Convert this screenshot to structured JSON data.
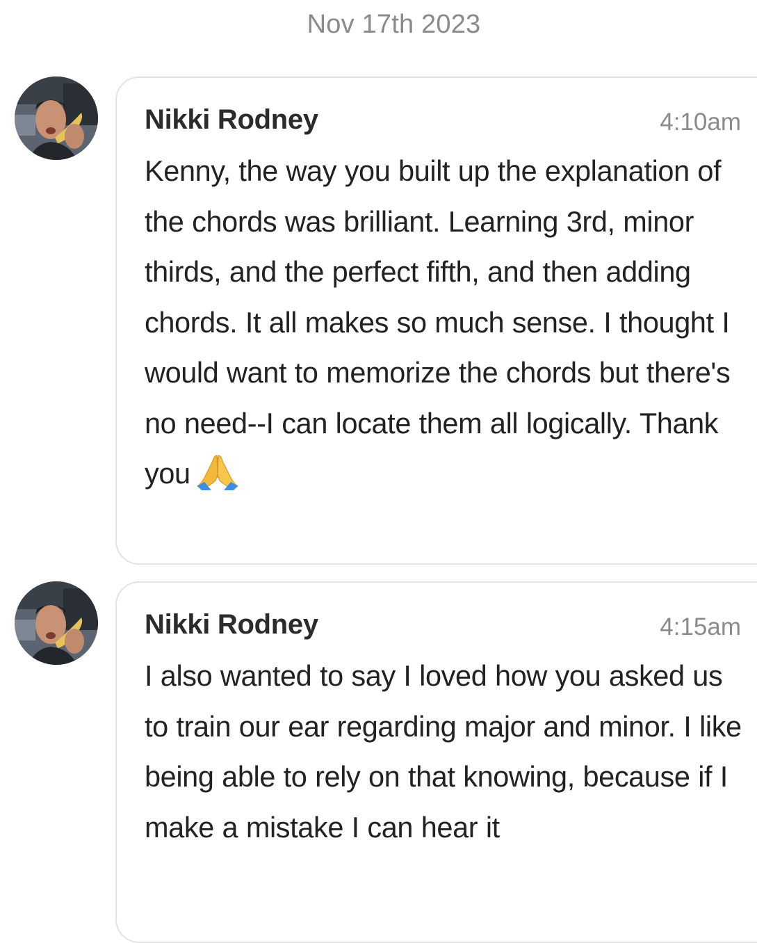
{
  "date_divider": "Nov 17th 2023",
  "messages": [
    {
      "sender": "Nikki Rodney",
      "time": "4:10am",
      "text": "Kenny, the way you built up the explanation of the chords was brilliant. Learning 3rd, minor thirds, and the perfect fifth, and then adding chords. It all makes so much sense. I thought I would want to memorize the chords but there's no need--I can locate them all logically. Thank you",
      "emoji": "folded-hands-icon"
    },
    {
      "sender": "Nikki Rodney",
      "time": "4:15am",
      "text": "I also wanted to say I loved how you asked us to train our ear regarding major and minor. I like being able to rely on that knowing, because if I make a mistake I can hear it"
    }
  ]
}
